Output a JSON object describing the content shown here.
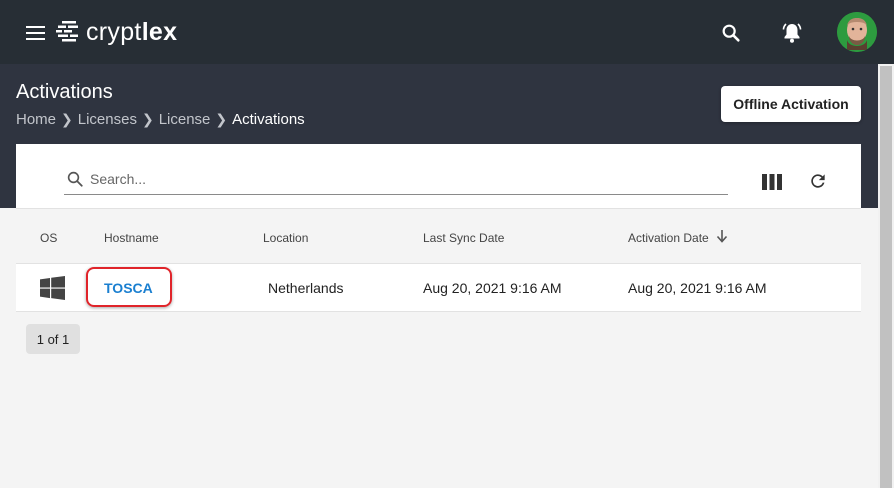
{
  "app": {
    "logo_text_light": "crypt",
    "logo_text_bold": "lex",
    "brand_color": "#272e35"
  },
  "topbar": {
    "menu_icon": "hamburger-icon",
    "search_icon": "search-icon",
    "notifications_icon": "bell-icon",
    "avatar": "user-avatar"
  },
  "page": {
    "title": "Activations",
    "breadcrumb": [
      "Home",
      "Licenses",
      "License",
      "Activations"
    ],
    "offline_button": "Offline Activation"
  },
  "search": {
    "placeholder": "Search..."
  },
  "toolbar": {
    "columns_icon": "view-columns-icon",
    "refresh_icon": "refresh-icon"
  },
  "table": {
    "headers": [
      "OS",
      "Hostname",
      "Location",
      "Last Sync Date",
      "Activation Date"
    ],
    "sort_column": "Activation Date",
    "sort_direction": "descending",
    "rows": [
      {
        "os_icon": "windows-icon",
        "hostname": "TOSCA",
        "location": "Netherlands",
        "last_sync": "Aug 20, 2021 9:16 AM",
        "activation_date": "Aug 20, 2021 9:16 AM"
      }
    ]
  },
  "pagination": {
    "label": "1 of 1"
  },
  "colors": {
    "link": "#1a7fd0",
    "highlight": "#e0242a",
    "header_band": "#2f3440"
  }
}
